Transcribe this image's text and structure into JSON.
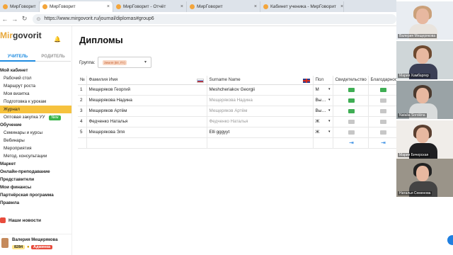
{
  "browser": {
    "tabs": [
      {
        "title": "МирГоворит",
        "active": false
      },
      {
        "title": "МирГоворит",
        "active": true
      },
      {
        "title": "МирГоворит - Отчёт",
        "active": false
      },
      {
        "title": "МирГоворит",
        "active": false
      },
      {
        "title": "Кабинет ученика - МирГоворит",
        "active": false
      }
    ],
    "url": "https://www.mirgovorit.ru/journal/diplomas#group6"
  },
  "sidebar": {
    "logo_a": "Mir",
    "logo_b": "govorit",
    "role_tabs": [
      "УЧИТЕЛЬ",
      "РОДИТЕЛЬ"
    ],
    "menu": [
      {
        "label": "Мой кабинет",
        "type": "hdr"
      },
      {
        "label": "Рабочий стол",
        "type": "sub"
      },
      {
        "label": "Маршрут роста",
        "type": "sub"
      },
      {
        "label": "Моя визитка",
        "type": "sub"
      },
      {
        "label": "Подготовка к урокам",
        "type": "sub"
      },
      {
        "label": "Журнал",
        "type": "sub",
        "active": true
      },
      {
        "label": "Оптовая закупка УУ",
        "type": "sub",
        "badge": "New"
      },
      {
        "label": "Обучение",
        "type": "hdr"
      },
      {
        "label": "Семинары и курсы",
        "type": "sub"
      },
      {
        "label": "Вебинары",
        "type": "sub"
      },
      {
        "label": "Мероприятия",
        "type": "sub"
      },
      {
        "label": "Метод. консультации",
        "type": "sub"
      },
      {
        "label": "Маркет",
        "type": "hdr"
      },
      {
        "label": "Онлайн-преподавание",
        "type": "hdr"
      },
      {
        "label": "Представители",
        "type": "hdr"
      },
      {
        "label": "Мои финансы",
        "type": "hdr"
      },
      {
        "label": "Партнёрская программа",
        "type": "hdr"
      },
      {
        "label": "Правила",
        "type": "hdr"
      }
    ],
    "news": "Наши новости",
    "user": {
      "name": "Валерия Мещерякова",
      "points": "8284",
      "role": "Админка"
    }
  },
  "main": {
    "title": "Дипломы",
    "group_label": "Группа:",
    "group_value": "Земля (Вт, Пт)",
    "table": {
      "headers": [
        "№",
        "Фамилия Имя",
        "Surname Name",
        "Пол",
        "Свидетельство",
        "Благодарность"
      ],
      "rows": [
        {
          "n": "1",
          "ru": "Мещеряков Георгий",
          "en": "Meshcheriakov Georgii",
          "en_grey": false,
          "sex": "М",
          "cert": "green",
          "thanks": "green"
        },
        {
          "n": "2",
          "ru": "Мещерякова Надина",
          "en": "Мещерякова Надина",
          "en_grey": true,
          "sex": "Вы…",
          "cert": "green",
          "thanks": "grey"
        },
        {
          "n": "3",
          "ru": "Мещеряков Артём",
          "en": "Мещеряков Артём",
          "en_grey": true,
          "sex": "Вы…",
          "cert": "green",
          "thanks": "grey"
        },
        {
          "n": "4",
          "ru": "Федченко Наталья",
          "en": "Федченко Наталья",
          "en_grey": true,
          "sex": "Ж",
          "cert": "grey",
          "thanks": "grey"
        },
        {
          "n": "5",
          "ru": "Мещерякова Эля",
          "en": "Elli gggyyt",
          "en_grey": false,
          "sex": "Ж",
          "cert": "grey",
          "thanks": "grey"
        }
      ]
    }
  },
  "video": {
    "tiles": [
      {
        "name": "Валерия Мещерякова",
        "bg": "#e9edf2",
        "hair": "#caa07a",
        "body": "#e9e4de"
      },
      {
        "name": "Мария Хамбаргер",
        "bg": "#cfd6d8",
        "hair": "#6e4a30",
        "body": "#3b3f55"
      },
      {
        "name": "Natalia Sorokina",
        "bg": "#9aa3a6",
        "hair": "#4b3a2e",
        "body": "#d9dcdc"
      },
      {
        "name": "Мария Бичерская",
        "bg": "#f0ede9",
        "hair": "#5b4030",
        "body": "#1f1f22"
      },
      {
        "name": "Наталья Семенова",
        "bg": "#9a9489",
        "hair": "#222",
        "body": "#444"
      }
    ]
  }
}
